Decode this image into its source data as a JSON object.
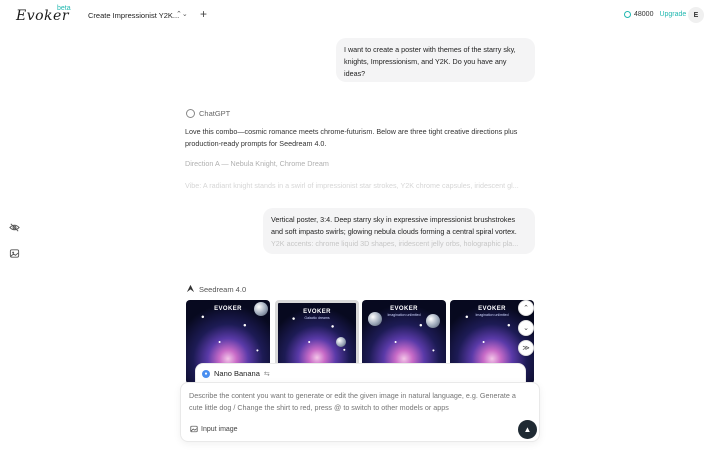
{
  "header": {
    "logo": "Evoker",
    "logo_badge": "beta",
    "project_title": "Create Impressionist Y2K...",
    "project_chevron": "⌃⌄",
    "new_button": "+",
    "credits": "48000",
    "upgrade": "Upgrade",
    "avatar": "E"
  },
  "conversation": {
    "user_message_1": "I want to create a poster with themes of the starry sky, knights, Impressionism, and Y2K. Do you have any ideas?",
    "assistant_name": "ChatGPT",
    "assistant_intro": "Love this combo—cosmic romance meets chrome-futurism. Below are three tight creative directions plus production-ready prompts for Seedream 4.0.",
    "direction_a": "Direction A — Nebula Knight, Chrome Dream",
    "vibe_line": "Vibe: A radiant knight stands in a swirl of impressionist star strokes, Y2K chrome capsules, iridescent gl...",
    "user_message_2_line1": "Vertical poster, 3:4. Deep starry sky in expressive impressionist brushstrokes",
    "user_message_2_line2": "and soft impasto swirls; glowing nebula clouds forming a central spiral vortex.",
    "user_message_2_line3": "Y2K accents: chrome liquid 3D shapes, iridescent jelly orbs, holographic pla...",
    "model_name": "Seedream 4.0"
  },
  "gallery": {
    "posters": [
      {
        "title": "EVOKER",
        "subtitle": ""
      },
      {
        "title": "EVOKER",
        "subtitle": "Galactic dreams"
      },
      {
        "title": "EVOKER",
        "subtitle": "Imagination unlimited"
      },
      {
        "title": "EVOKER",
        "subtitle": "Imagination unlimited"
      }
    ],
    "ctrl_up": "⌃",
    "ctrl_down": "⌄",
    "ctrl_more": "≫"
  },
  "composer": {
    "model": "Nano Banana",
    "swap_icon": "⇆",
    "placeholder": "Describe the content you want to generate or edit the given image in natural language, e.g. Generate a cute little dog / Change the shirt to red, press @ to switch to other models or apps",
    "input_image": "Input image",
    "send": "▲"
  },
  "side_icons": [
    "eye-off-icon",
    "gallery-icon"
  ],
  "colors": {
    "accent": "#22b8b0",
    "send_button": "#1f2a33",
    "bubble": "#f4f4f5"
  }
}
